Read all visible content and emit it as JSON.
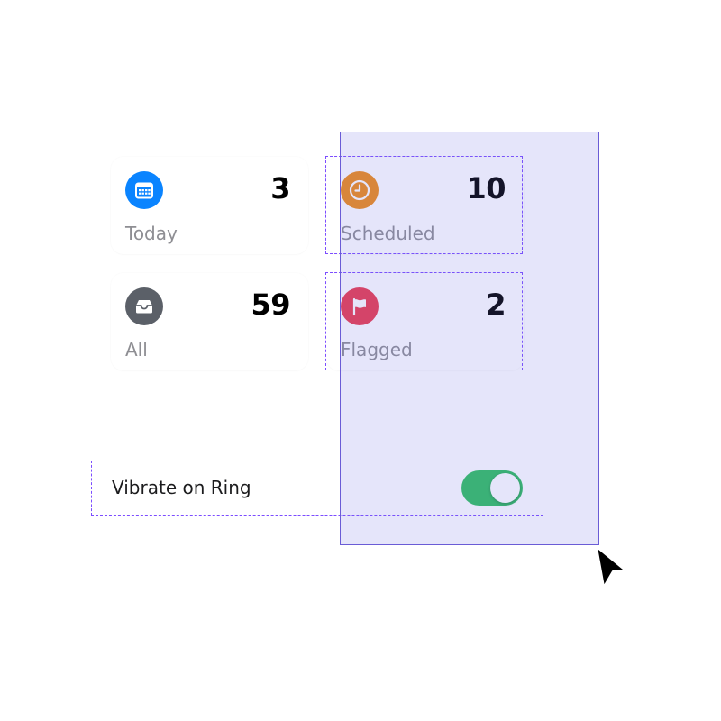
{
  "tiles": {
    "today": {
      "label": "Today",
      "count": "3",
      "icon": "calendar-icon",
      "color": "#0a84ff"
    },
    "scheduled": {
      "label": "Scheduled",
      "count": "10",
      "icon": "clock-icon",
      "color": "#f08c16"
    },
    "all": {
      "label": "All",
      "count": "59",
      "icon": "tray-icon",
      "color": "#5b6068"
    },
    "flagged": {
      "label": "Flagged",
      "count": "2",
      "icon": "flag-icon",
      "color": "#eb3b4f"
    }
  },
  "settings": {
    "vibrate_on_ring": {
      "label": "Vibrate on Ring",
      "enabled": true,
      "toggle_color": "#30c060"
    }
  },
  "overlay": {
    "selection_color": "#6a5cd6",
    "highlight_color": "#7c4dff",
    "cursor_icon": "arrow-cursor-icon"
  }
}
